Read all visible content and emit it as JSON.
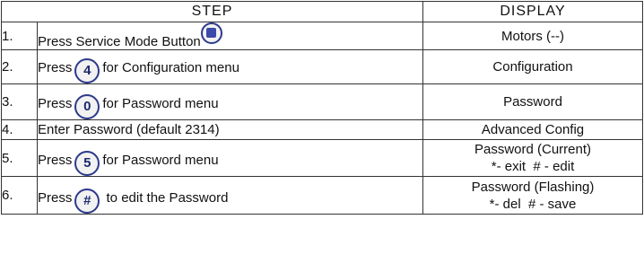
{
  "headers": {
    "step": "STEP",
    "display": "DISPLAY"
  },
  "rows": [
    {
      "num": "1.",
      "pre": "Press Service Mode Button",
      "button": "",
      "post": "",
      "display": [
        "Motors (--)"
      ]
    },
    {
      "num": "2.",
      "pre": "Press",
      "button": "4",
      "post": "for Configuration menu",
      "display": [
        "Configuration"
      ]
    },
    {
      "num": "3.",
      "pre": "Press",
      "button": "0",
      "post": "for Password menu",
      "display": [
        "Password"
      ]
    },
    {
      "num": "4.",
      "pre": "Enter Password (default 2314)",
      "button": "",
      "post": "",
      "display": [
        "Advanced Config"
      ]
    },
    {
      "num": "5.",
      "pre": "Press",
      "button": "5",
      "post": "for Password menu",
      "display": [
        "Password (Current)",
        "*- exit  # - edit"
      ]
    },
    {
      "num": "6.",
      "pre": "Press",
      "button": "#",
      "post": " to edit the Password",
      "display": [
        "Password (Flashing)",
        "*- del  # - save"
      ]
    }
  ],
  "icons": {
    "service_button": "service-mode-square-button-icon"
  }
}
